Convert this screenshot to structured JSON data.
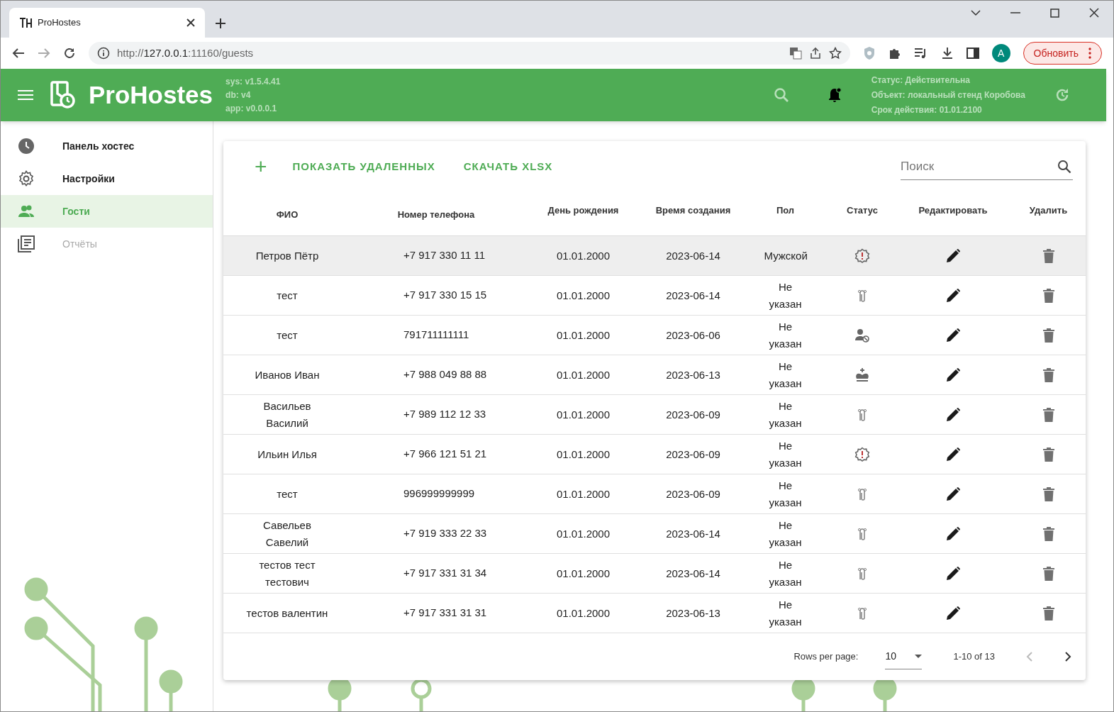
{
  "browser": {
    "tab_title": "ProHostes",
    "url_prefix": "http://",
    "url_host": "127.0.0.1",
    "url_rest": ":11160/guests",
    "profile_initial": "A",
    "update_button": "Обновить"
  },
  "header": {
    "brand": "ProHostes",
    "versions": [
      "sys: v1.5.4.41",
      "db: v4",
      "app: v0.0.0.1"
    ],
    "license": [
      "Статус: Действительна",
      "Объект: локальный стенд Коробова",
      "Срок действия: 01.01.2100"
    ]
  },
  "sidebar": {
    "items": [
      {
        "label": "Панель хостес",
        "kind": "clock",
        "selected": false,
        "disabled": false
      },
      {
        "label": "Настройки",
        "kind": "gear",
        "selected": false,
        "disabled": false
      },
      {
        "label": "Гости",
        "kind": "people",
        "selected": true,
        "disabled": false
      },
      {
        "label": "Отчёты",
        "kind": "document",
        "selected": false,
        "disabled": true
      }
    ]
  },
  "toolbar": {
    "add": "+",
    "show_deleted": "ПОКАЗАТЬ УДАЛЕННЫХ",
    "download": "СКАЧАТЬ XLSX",
    "search_placeholder": "Поиск"
  },
  "table": {
    "columns": [
      "ФИО",
      "Номер телефона",
      "День рождения",
      "Время создания",
      "Пол",
      "Статус",
      "Редактировать",
      "Удалить"
    ],
    "rows": [
      {
        "name": "Петров Пётр",
        "phone": "+7 917 330 11 11",
        "birthday": "01.01.2000",
        "created": "2023-06-14",
        "gender": "Мужской",
        "kind": "alert",
        "highlighted": true
      },
      {
        "name": "тест",
        "phone": "+7 917 330 15 15",
        "birthday": "01.01.2000",
        "created": "2023-06-14",
        "gender": "Не указан",
        "kind": "clip",
        "highlighted": false
      },
      {
        "name": "тест",
        "phone": "791711111111",
        "birthday": "01.01.2000",
        "created": "2023-06-06",
        "gender": "Не указан",
        "kind": "blocked",
        "highlighted": false
      },
      {
        "name": "Иванов Иван",
        "phone": "+7 988 049 88 88",
        "birthday": "01.01.2000",
        "created": "2023-06-13",
        "gender": "Не указан",
        "kind": "crown",
        "highlighted": false
      },
      {
        "name": "Васильев Василий",
        "phone": "+7 989 112 12 33",
        "birthday": "01.01.2000",
        "created": "2023-06-09",
        "gender": "Не указан",
        "kind": "clip",
        "highlighted": false
      },
      {
        "name": "Ильин Илья",
        "phone": "+7 966 121 51 21",
        "birthday": "01.01.2000",
        "created": "2023-06-09",
        "gender": "Не указан",
        "kind": "alert",
        "highlighted": false
      },
      {
        "name": "тест",
        "phone": "996999999999",
        "birthday": "01.01.2000",
        "created": "2023-06-09",
        "gender": "Не указан",
        "kind": "clip",
        "highlighted": false
      },
      {
        "name": "Савельев Савелий",
        "phone": "+7 919 333 22 33",
        "birthday": "01.01.2000",
        "created": "2023-06-14",
        "gender": "Не указан",
        "kind": "clip",
        "highlighted": false
      },
      {
        "name": "тестов тест тестович",
        "phone": "+7 917 331 31 34",
        "birthday": "01.01.2000",
        "created": "2023-06-14",
        "gender": "Не указан",
        "kind": "clip",
        "highlighted": false
      },
      {
        "name": "тестов валентин",
        "phone": "+7 917 331 31 31",
        "birthday": "01.01.2000",
        "created": "2023-06-13",
        "gender": "Не указан",
        "kind": "clip",
        "highlighted": false
      }
    ]
  },
  "pagination": {
    "rows_per_page_label": "Rows per page:",
    "rows_per_page": "10",
    "range": "1-10 of 13"
  }
}
